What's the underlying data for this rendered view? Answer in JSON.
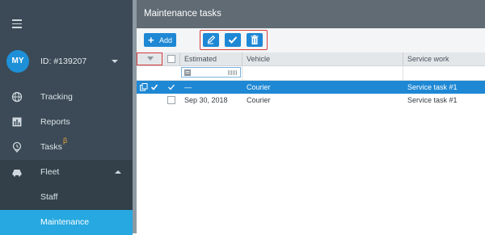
{
  "sidebar": {
    "user": {
      "initials": "MY",
      "id_label": "ID: #139207"
    },
    "items": [
      {
        "label": "Tracking",
        "icon": "globe-icon"
      },
      {
        "label": "Reports",
        "icon": "bar-chart-icon"
      },
      {
        "label": "Tasks",
        "icon": "map-pin-icon",
        "badge": "β"
      },
      {
        "label": "Fleet",
        "icon": "car-icon"
      },
      {
        "label": "Staff"
      },
      {
        "label": "Maintenance"
      }
    ]
  },
  "panel": {
    "title": "Maintenance tasks"
  },
  "toolbar": {
    "add_label": "Add"
  },
  "grid": {
    "columns": [
      "Estimated",
      "Vehicle",
      "Service work"
    ],
    "rows": [
      {
        "estimated": "—",
        "vehicle": "Courier",
        "service": "Service task #1",
        "selected": true
      },
      {
        "estimated": "Sep 30, 2018",
        "vehicle": "Courier",
        "service": "Service task #1",
        "selected": false
      }
    ]
  },
  "colors": {
    "accent": "#1e88d4",
    "sidebar": "#3b4a56",
    "active": "#27a8e0",
    "highlight": "#d83b3b"
  }
}
